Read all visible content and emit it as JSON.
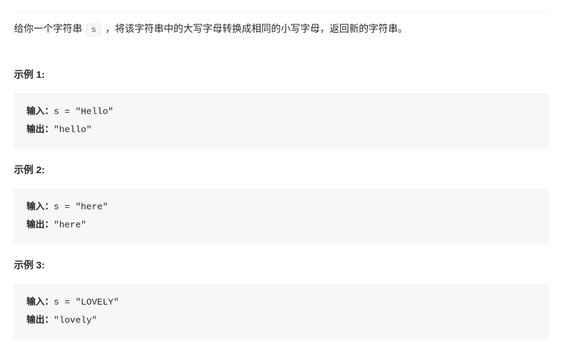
{
  "problem": {
    "description_pre": "给你一个字符串 ",
    "var": "s",
    "description_post": " ，将该字符串中的大写字母转换成相同的小写字母，返回新的字符串。"
  },
  "examples": [
    {
      "title": "示例 1:",
      "input_label": "输入：",
      "input_value": "s = \"Hello\"",
      "output_label": "输出：",
      "output_value": "\"hello\""
    },
    {
      "title": "示例 2:",
      "input_label": "输入：",
      "input_value": "s = \"here\"",
      "output_label": "输出：",
      "output_value": "\"here\""
    },
    {
      "title": "示例 3:",
      "input_label": "输入：",
      "input_value": "s = \"LOVELY\"",
      "output_label": "输出：",
      "output_value": "\"lovely\""
    }
  ]
}
